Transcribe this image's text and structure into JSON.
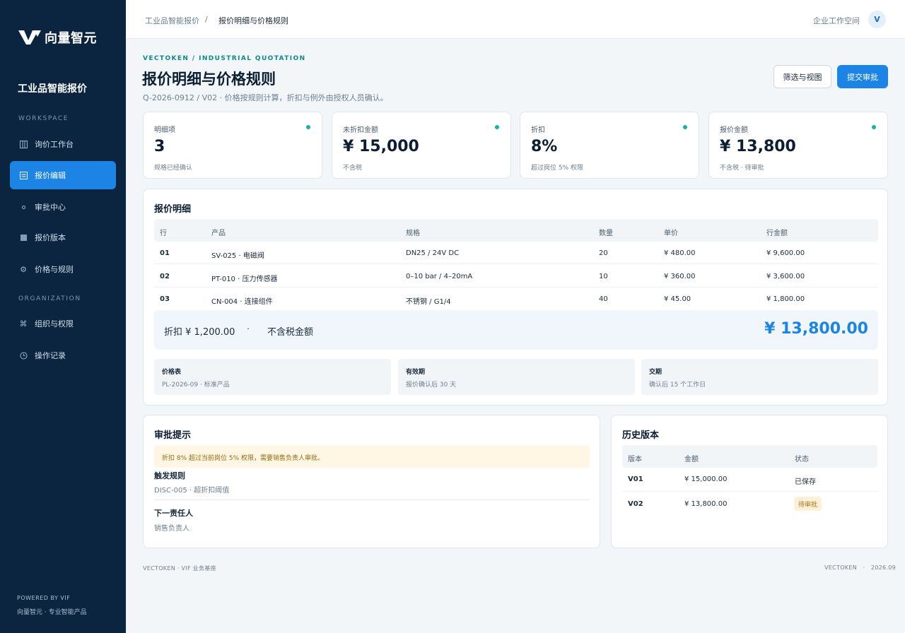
{
  "brand": {
    "name": "向量智元",
    "product": "工业品智能报价",
    "accent": "#1c84e4",
    "sidebar_bg": "#0b2540"
  },
  "sidebar": {
    "workspace_label": "WORKSPACE",
    "organization_label": "ORGANIZATION",
    "items": [
      {
        "label": "询价工作台",
        "icon": "columns-icon"
      },
      {
        "label": "报价编辑",
        "icon": "document-list-icon",
        "active": true
      },
      {
        "label": "审批中心",
        "icon": "dot-icon"
      },
      {
        "label": "报价版本",
        "icon": "stack-icon"
      },
      {
        "label": "价格与规则",
        "icon": "gear-icon"
      },
      {
        "label": "组织与权限",
        "icon": "command-icon"
      },
      {
        "label": "操作记录",
        "icon": "clock-icon"
      }
    ],
    "powered_by": "POWERED BY VIF",
    "powered_sub": "向量智元 · 专业智能产品"
  },
  "topbar": {
    "breadcrumb": [
      "工业品智能报价",
      "/",
      "报价明细与价格规则"
    ],
    "workspace": "企业工作空间",
    "avatar": "V"
  },
  "header": {
    "eyebrow": "VECTOKEN / INDUSTRIAL QUOTATION",
    "title": "报价明细与价格规则",
    "subtitle": "Q-2026-0912 / V02 · 价格按规则计算，折扣与例外由授权人员确认。",
    "filter_button": "筛选与视图",
    "submit_button": "提交审批"
  },
  "metrics": [
    {
      "label": "明细项",
      "value": "3",
      "note": "规格已经确认"
    },
    {
      "label": "未折扣金额",
      "value": "¥ 15,000",
      "note": "不含税"
    },
    {
      "label": "折扣",
      "value": "8%",
      "note": "超过岗位 5% 权限"
    },
    {
      "label": "报价金额",
      "value": "¥ 13,800",
      "note": "不含税 · 待审批"
    }
  ],
  "detail": {
    "title": "报价明细",
    "columns": [
      "行",
      "产品",
      "规格",
      "数量",
      "单价",
      "行金额"
    ],
    "rows": [
      [
        "01",
        "SV-025 · 电磁阀",
        "DN25 / 24V DC",
        "20",
        "¥ 480.00",
        "¥ 9,600.00"
      ],
      [
        "02",
        "PT-010 · 压力传感器",
        "0–10 bar / 4–20mA",
        "10",
        "¥ 360.00",
        "¥ 3,600.00"
      ],
      [
        "03",
        "CN-004 · 连接组件",
        "不锈钢 / G1/4",
        "40",
        "¥ 45.00",
        "¥ 1,800.00"
      ]
    ],
    "discount": "折扣 ¥ 1,200.00",
    "separator": "·",
    "pretax_label": "不含税金额",
    "total": "¥ 13,800.00",
    "info": [
      {
        "label": "价格表",
        "value": "PL-2026-09 · 标准产品"
      },
      {
        "label": "有效期",
        "value": "报价确认后 30 天"
      },
      {
        "label": "交期",
        "value": "确认后 15 个工作日"
      }
    ]
  },
  "approval": {
    "title": "审批提示",
    "warning": "折扣 8% 超过当前岗位 5% 权限，需要销售负责人审批。",
    "trigger_label": "触发规则",
    "trigger_value": "DISC-005 · 超折扣阈值",
    "assignee_label": "下一责任人",
    "assignee_value": "销售负责人"
  },
  "history": {
    "title": "历史版本",
    "columns": [
      "版本",
      "金额",
      "状态"
    ],
    "rows": [
      {
        "version": "V01",
        "amount": "¥ 15,000.00",
        "status": "已保存"
      },
      {
        "version": "V02",
        "amount": "¥ 13,800.00",
        "status": "待审批"
      }
    ]
  },
  "footer": {
    "left": "VECTOKEN   ·   VIF 业务基座",
    "right": "VECTOKEN   ·   2026.09"
  }
}
